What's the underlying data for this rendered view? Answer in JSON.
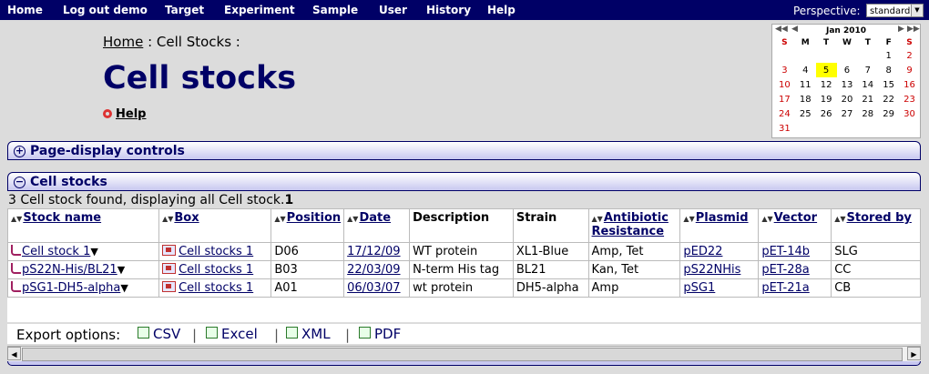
{
  "nav": {
    "items": [
      "Home",
      "Log out demo",
      "Target",
      "Experiment",
      "Sample",
      "User",
      "History",
      "Help"
    ],
    "perspective_label": "Perspective:",
    "perspective_value": "standard"
  },
  "breadcrumb": {
    "home": "Home",
    "rest": " : Cell Stocks :"
  },
  "page_title": "Cell stocks",
  "help_label": "Help",
  "calendar": {
    "month_label": "Jan 2010",
    "weekdays": [
      "S",
      "M",
      "T",
      "W",
      "T",
      "F",
      "S"
    ],
    "weeks": [
      [
        "",
        "",
        "",
        "",
        "",
        "1",
        "2"
      ],
      [
        "3",
        "4",
        "5",
        "6",
        "7",
        "8",
        "9"
      ],
      [
        "10",
        "11",
        "12",
        "13",
        "14",
        "15",
        "16"
      ],
      [
        "17",
        "18",
        "19",
        "20",
        "21",
        "22",
        "23"
      ],
      [
        "24",
        "25",
        "26",
        "27",
        "28",
        "29",
        "30"
      ],
      [
        "31",
        "",
        "",
        "",
        "",
        "",
        ""
      ]
    ],
    "today": "5"
  },
  "panels": {
    "controls_title": "Page-display controls",
    "stocks_title": "Cell stocks"
  },
  "found_text": "3 Cell stock found, displaying all Cell stock.",
  "found_count": "1",
  "table": {
    "headers": [
      "Stock name",
      "Box",
      "Position",
      "Date",
      "Description",
      "Strain",
      "Antibiotic Resistance",
      "Plasmid",
      "Vector",
      "Stored by"
    ],
    "rows": [
      [
        "Cell stock  1",
        "Cell stocks 1",
        "D06",
        "17/12/09",
        "WT protein",
        "XL1-Blue",
        "Amp, Tet",
        "pED22",
        "pET-14b",
        "SLG"
      ],
      [
        "pS22N-His/BL21",
        "Cell stocks 1",
        "B03",
        "22/03/09",
        "N-term His tag",
        "BL21",
        "Kan, Tet",
        "pS22NHis",
        "pET-28a",
        "CC"
      ],
      [
        "pSG1-DH5-alpha",
        "Cell stocks 1",
        "A01",
        "06/03/07",
        "wt protein",
        "DH5-alpha",
        "Amp",
        "pSG1",
        "pET-21a",
        "CB"
      ]
    ]
  },
  "export": {
    "label": "Export options:",
    "options": [
      "CSV",
      "Excel",
      "XML",
      "PDF"
    ]
  }
}
